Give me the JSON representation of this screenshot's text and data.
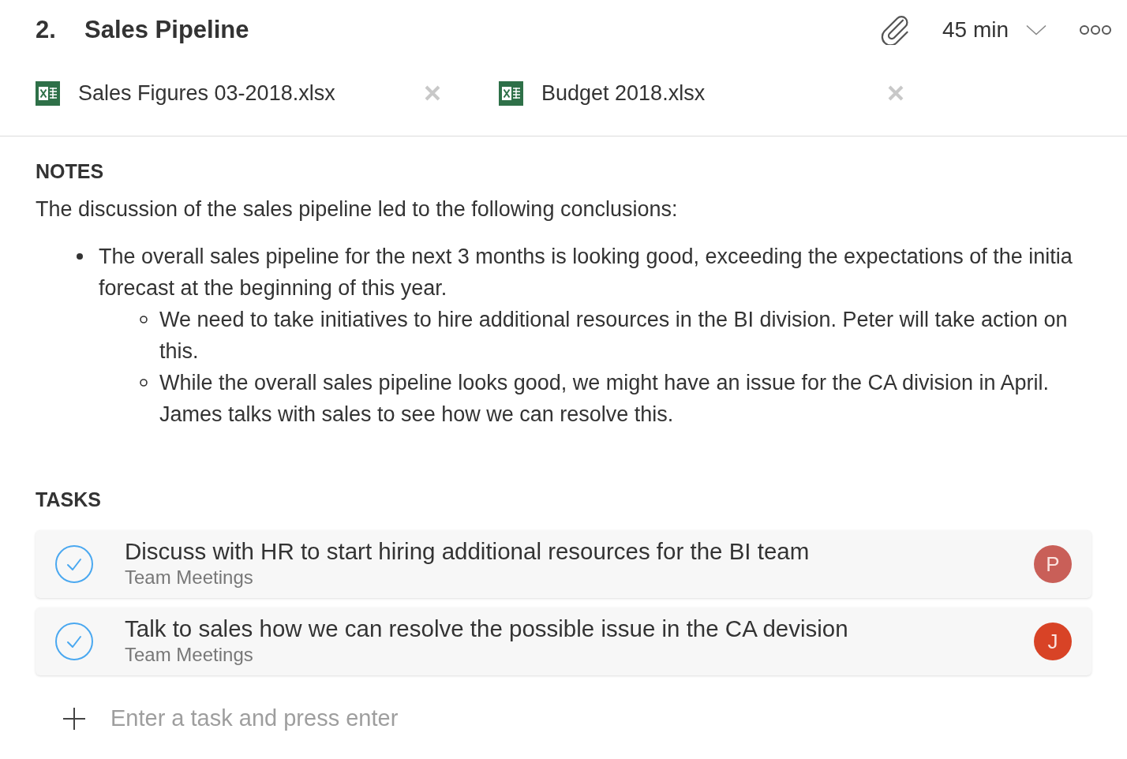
{
  "agenda_item": {
    "number": "2.",
    "title": "Sales Pipeline",
    "duration": "45 min"
  },
  "attachments": [
    {
      "name": "Sales Figures 03-2018.xlsx"
    },
    {
      "name": "Budget 2018.xlsx"
    }
  ],
  "notes": {
    "heading": "NOTES",
    "intro": "The discussion of the sales pipeline led to the following conclusions:",
    "bullets": [
      {
        "text": "The overall sales pipeline for the next 3 months is looking good, exceeding the expectations of the initia forecast at the beginning of this year.",
        "children": [
          {
            "text": "We need to take initiatives to hire additional resources in the BI division. Peter will take action on this."
          },
          {
            "text": "While the overall sales pipeline looks good, we might have an issue for the CA division in April. James talks with sales to see how we can resolve this."
          }
        ]
      }
    ]
  },
  "tasks": {
    "heading": "TASKS",
    "items": [
      {
        "title": "Discuss with HR to start hiring additional resources for the BI team",
        "project": "Team Meetings",
        "assignee": "P",
        "color": "#c95f58"
      },
      {
        "title": "Talk to sales how we can resolve the possible issue in the CA devision",
        "project": "Team Meetings",
        "assignee": "J",
        "color": "#d84326"
      }
    ],
    "new_task": {
      "placeholder": "Enter a task and press enter"
    }
  }
}
